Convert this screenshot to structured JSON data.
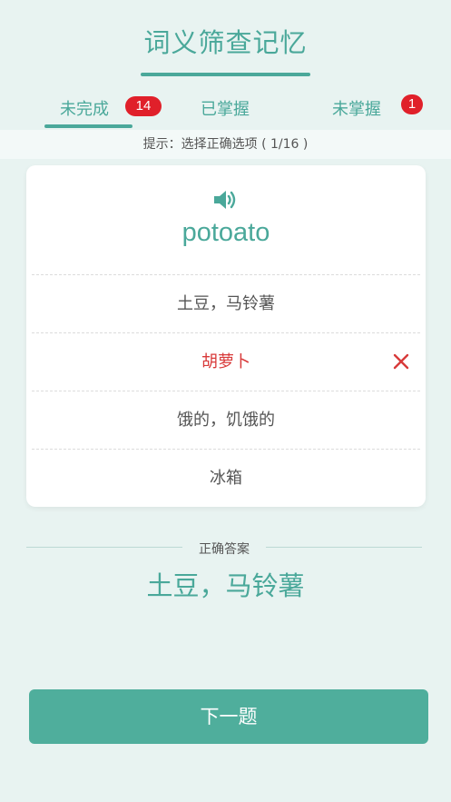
{
  "header": {
    "title": "词义筛查记忆"
  },
  "tabs": [
    {
      "label": "未完成",
      "badge": "14"
    },
    {
      "label": "已掌握"
    },
    {
      "label": "未掌握",
      "badge": "1"
    }
  ],
  "hint": "提示：选择正确选项 ( 1/16 )",
  "card": {
    "speaker_icon": "speaker-icon",
    "word": "potoato",
    "options": [
      {
        "label": "土豆，马铃薯"
      },
      {
        "label": "胡萝卜",
        "state": "wrong"
      },
      {
        "label": "饿的，饥饿的"
      },
      {
        "label": "冰箱"
      }
    ],
    "wrong_icon": "close-icon"
  },
  "answer": {
    "label": "正确答案",
    "value": "土豆，马铃薯"
  },
  "next_button": "下一题",
  "colors": {
    "accent": "#4aa89a",
    "button": "#4fae9c",
    "badge": "#e0202a",
    "wrong": "#d83a3a",
    "background": "#e8f3f1"
  }
}
